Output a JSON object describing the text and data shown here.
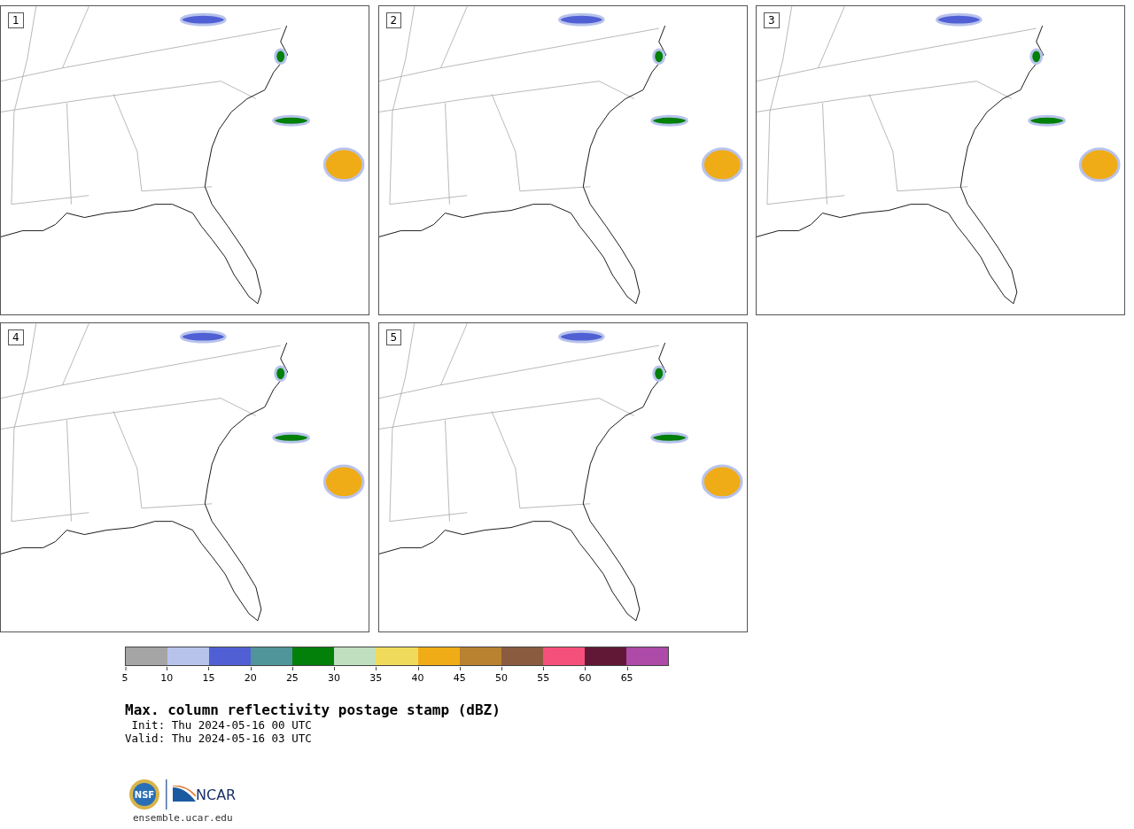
{
  "panels": [
    {
      "number": "1"
    },
    {
      "number": "2"
    },
    {
      "number": "3"
    },
    {
      "number": "4"
    },
    {
      "number": "5"
    }
  ],
  "colorbar": {
    "segments": [
      {
        "color": "#a5a5a5"
      },
      {
        "color": "#b8c3ec"
      },
      {
        "color": "#5060d4"
      },
      {
        "color": "#4f9599"
      },
      {
        "color": "#02800a"
      },
      {
        "color": "#bfdfbf"
      },
      {
        "color": "#f0da5c"
      },
      {
        "color": "#f0ac17"
      },
      {
        "color": "#b98231"
      },
      {
        "color": "#8b5b3f"
      },
      {
        "color": "#f5507b"
      },
      {
        "color": "#601836"
      },
      {
        "color": "#ae4aa8"
      }
    ],
    "ticks": [
      "5",
      "10",
      "15",
      "20",
      "25",
      "30",
      "35",
      "40",
      "45",
      "50",
      "55",
      "60",
      "65"
    ]
  },
  "title": "Max. column reflectivity postage stamp (dBZ)",
  "init": " Init: Thu 2024-05-16 00 UTC",
  "valid": "Valid: Thu 2024-05-16 03 UTC",
  "logos": {
    "nsf": "NSF",
    "ncar": "NCAR"
  },
  "site": "ensemble.ucar.edu"
}
